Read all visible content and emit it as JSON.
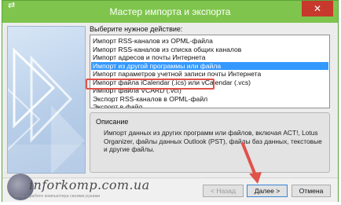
{
  "window": {
    "title": "Мастер импорта и экспорта",
    "icon": "⇄",
    "close_label": "✕"
  },
  "prompt": "Выберите нужное действие:",
  "actions": [
    "Импорт RSS-каналов из OPML-файла",
    "Импорт RSS-каналов из списка общих каналов",
    "Импорт адресов и почты Интернета",
    "Импорт из другой программы или файла",
    "Импорт параметров учетной записи почты Интернета",
    "Импорт файла iCalendar (.ics) или vCalendar (.vcs)",
    "Импорт файла VCARD (.vcf)",
    "Экспорт RSS-каналов в OPML-файл",
    "Экспорт в файл"
  ],
  "selected_index": 3,
  "description": {
    "title": "Описание",
    "text": "Импорт данных из других программ или файлов, включая ACT!, Lotus Organizer, файлы данных Outlook (PST), файлы баз данных, текстовые и другие файлы."
  },
  "buttons": {
    "back": "< Назад",
    "next": "Далее >",
    "cancel": "Отмена"
  },
  "watermark": {
    "site": "inforkomp.com.ua",
    "tagline": "Весь о работе компьютера своими руками"
  },
  "colors": {
    "titlebar": "#7fc54d",
    "selection": "#3399ff",
    "highlight": "#e0524a",
    "close": "#c7382d"
  }
}
